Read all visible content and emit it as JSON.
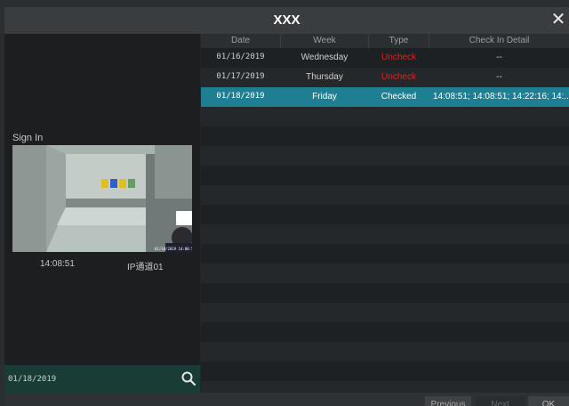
{
  "window": {
    "title": "XXX",
    "close_icon": "close-icon"
  },
  "left": {
    "sign_in_label": "Sign In",
    "snapshot": {
      "time": "14:08:51",
      "camera": "IP通道01"
    },
    "search": {
      "date_value": "01/18/2019",
      "icon": "search-icon"
    }
  },
  "table": {
    "columns": [
      "Date",
      "Week",
      "Type",
      "Check In Detail"
    ],
    "rows": [
      {
        "date": "01/16/2019",
        "week": "Wednesday",
        "type": "Uncheck",
        "detail": "--"
      },
      {
        "date": "01/17/2019",
        "week": "Thursday",
        "type": "Uncheck",
        "detail": "--"
      },
      {
        "date": "01/18/2019",
        "week": "Friday",
        "type": "Checked",
        "detail": "14:08:51; 14:08:51; 14:22:16; 14:..."
      }
    ],
    "selected_row": 2
  },
  "buttons": {
    "previous": "Previous",
    "next": "Next",
    "ok": "OK"
  },
  "colors": {
    "accent": "#1f7f92",
    "uncheck": "#e02020",
    "search_bar": "#1a3c36"
  }
}
